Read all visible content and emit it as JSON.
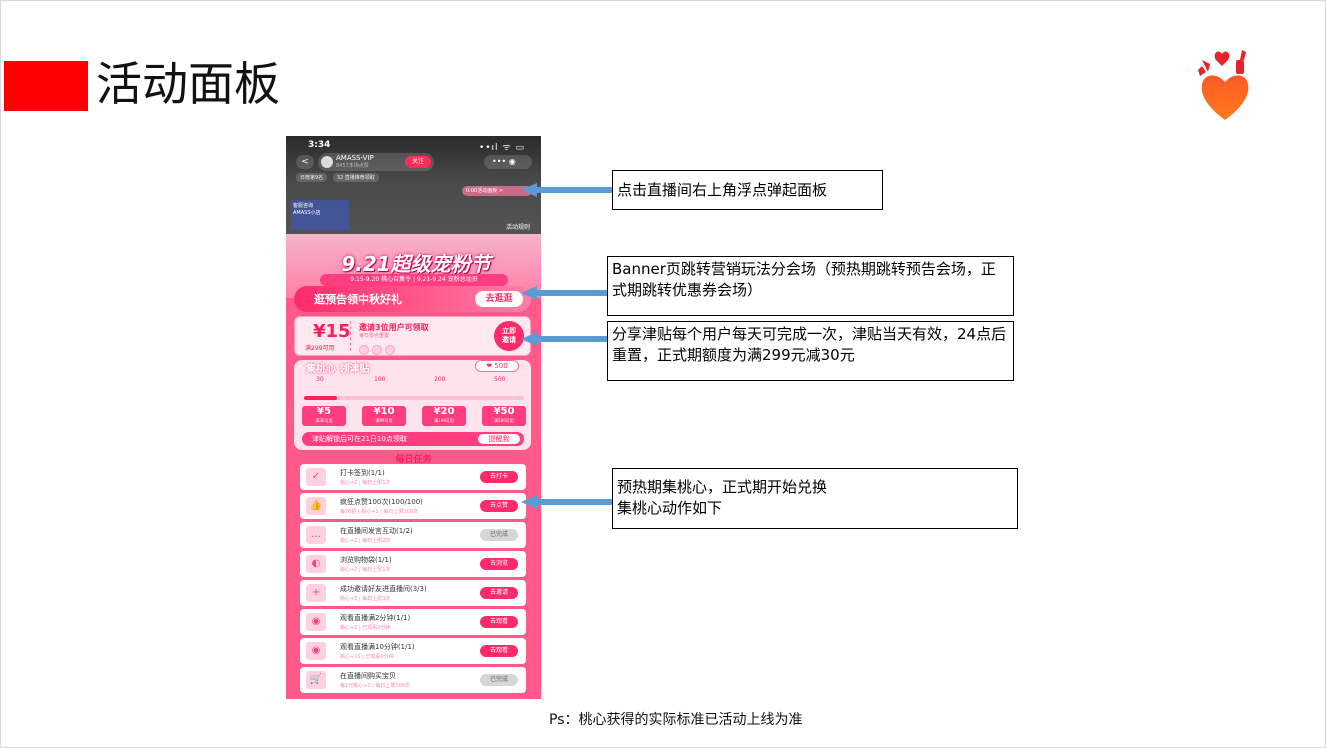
{
  "slide": {
    "title": "活动面板",
    "accent_color": "#ff0000",
    "ps_note": "Ps：桃心获得的实际标准已活动上线为准"
  },
  "phone": {
    "status": {
      "time": "3:34",
      "signal": "••ıl ᯤ ▭"
    },
    "live_header": {
      "back_icon": "chevron-left-icon",
      "back_glyph": "<",
      "anchor_name": "AMASS-VIP",
      "anchor_sub": "8457本场点赞",
      "follow_label": "关注",
      "more_label": "•••  ◉",
      "tags": [
        "日榜第9名",
        "32 直播推荐领取"
      ],
      "float_text": "0:00活动面板 >",
      "side_title": "客服咨询",
      "side_sub": "AMASS小店",
      "rules_label": "活动规则"
    },
    "banner": {
      "title": "9.21超级宠粉节",
      "subtitle": "9.15-9.20 桃心召集令 | 9.21-9.24 宠粉总动员"
    },
    "cta": {
      "text": "逛预告领中秋好礼",
      "button": "去逛逛"
    },
    "invite": {
      "coupon_value": "¥15",
      "coupon_condition": "满299可用",
      "title": "邀请3位用户可领取",
      "subtitle": "每日零点重置",
      "button_line1": "立即",
      "button_line2": "邀请"
    },
    "peach": {
      "title": "集桃心 领津贴",
      "count": "❤ 500",
      "progress": 0.15,
      "milestones": [
        "30",
        "100",
        "200",
        "500"
      ],
      "vouchers": [
        {
          "value": "¥5",
          "condition": "满30可用"
        },
        {
          "value": "¥10",
          "condition": "满99可用"
        },
        {
          "value": "¥20",
          "condition": "满199可用"
        },
        {
          "value": "¥50",
          "condition": "满500可用"
        }
      ],
      "unlock_text": "津贴解锁后可在21日10点领取",
      "unlock_button": "提醒我"
    },
    "tasks_title": "每日任务",
    "tasks": [
      {
        "name": "打卡签到(1/1)",
        "desc": "桃心+2 | 每日上限1次",
        "button": "去打卡",
        "done": false,
        "icon": "✓"
      },
      {
        "name": "疯狂点赞100次(100/100)",
        "desc": "每20赞 | 桃心+1 | 每日上限100次",
        "button": "去点赞",
        "done": false,
        "icon": "👍"
      },
      {
        "name": "在直播间发言互动(1/2)",
        "desc": "桃心+2 | 每日上限2次",
        "button": "已完成",
        "done": true,
        "icon": "…"
      },
      {
        "name": "浏览购物袋(1/1)",
        "desc": "桃心+2 | 每日上限1次",
        "button": "去浏览",
        "done": false,
        "icon": "◐"
      },
      {
        "name": "成功邀请好友进直播间(3/3)",
        "desc": "桃心+5 | 每日上限3次",
        "button": "去邀请",
        "done": false,
        "icon": "+"
      },
      {
        "name": "观看直播满2分钟(1/1)",
        "desc": "桃心+2 | 已观看2分钟",
        "button": "去观看",
        "done": false,
        "icon": "◉"
      },
      {
        "name": "观看直播满10分钟(1/1)",
        "desc": "桃心+10 | 已观看0分钟",
        "button": "去观看",
        "done": false,
        "icon": "◉"
      },
      {
        "name": "在直播间购买宝贝",
        "desc": "每1元桃心+1 | 每日上限100次",
        "button": "已完成",
        "done": true,
        "icon": "🛒"
      }
    ]
  },
  "callouts": [
    {
      "text": "点击直播间右上角浮点弹起面板"
    },
    {
      "text": "Banner页跳转营销玩法分会场（预热期跳转预告会场，正式期跳转优惠券会场）"
    },
    {
      "text": "分享津贴每个用户每天可完成一次，津贴当天有效，24点后重置，正式期额度为满299元减30元"
    },
    {
      "text": "预热期集桃心，正式期开始兑换\n集桃心动作如下"
    }
  ],
  "colors": {
    "arrow": "#5b9bd5",
    "phone_pink": "#ff5a8a",
    "brand_pink": "#ff2a6b"
  }
}
